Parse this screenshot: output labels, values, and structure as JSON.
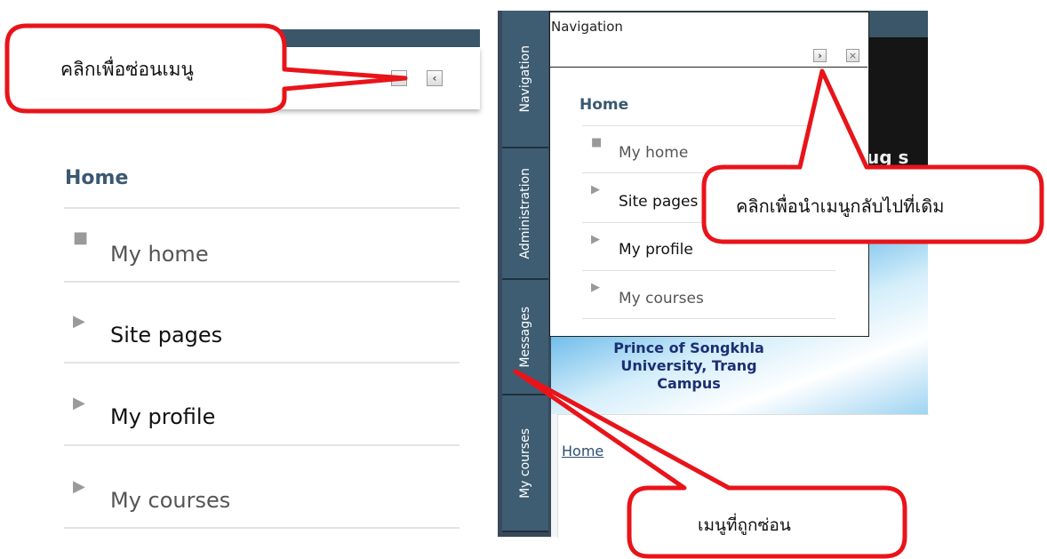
{
  "left_panel": {
    "home_label": "Home",
    "items": [
      {
        "label": "My home",
        "icon": "square-bullet-icon"
      },
      {
        "label": "Site pages",
        "icon": "triangle-right-icon"
      },
      {
        "label": "My profile",
        "icon": "triangle-right-icon"
      },
      {
        "label": "My courses",
        "icon": "triangle-right-icon"
      }
    ],
    "minimize_icon": "minus-icon",
    "dock_icon": "chevron-left-icon"
  },
  "right_screenshot": {
    "dock_tabs": [
      "Navigation",
      "Administration",
      "Messages",
      "My courses"
    ],
    "nav_popup": {
      "title": "Navigation",
      "home_label": "Home",
      "items": [
        {
          "label": "My home",
          "icon": "square-bullet-icon"
        },
        {
          "label": "Site pages",
          "icon": "triangle-right-icon"
        },
        {
          "label": "My profile",
          "icon": "triangle-right-icon"
        },
        {
          "label": "My courses",
          "icon": "triangle-right-icon"
        }
      ],
      "undock_icon": "chevron-right-icon",
      "close_icon": "close-icon"
    },
    "university_name_lines": [
      "Prince of Songkhla",
      "University, Trang",
      "Campus"
    ],
    "breadcrumb": "Home",
    "partial_text": "ug s"
  },
  "callouts": {
    "hide_menu": "คลิกเพื่อซ่อนเมนู",
    "restore_menu": "คลิกเพื่อนำเมนูกลับไปที่เดิม",
    "hidden_menu": "เมนูที่ถูกซ่อน"
  },
  "colors": {
    "callout_border": "#e8141a",
    "header_bar": "#3b5668",
    "home_heading": "#3a5870"
  }
}
